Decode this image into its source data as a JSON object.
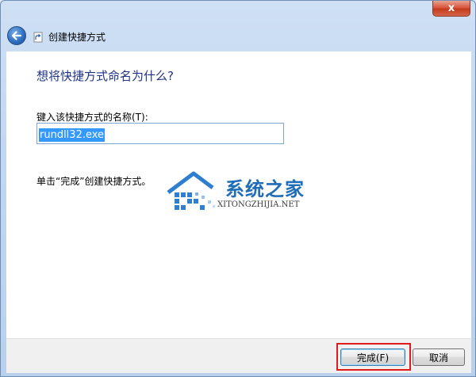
{
  "window": {
    "close_label": "x",
    "title": "创建快捷方式"
  },
  "page": {
    "heading": "想将快捷方式命名为什么?",
    "field_label": "键入该快捷方式的名称(T):",
    "name_value": "rundll32.exe",
    "hint": "单击“完成”创建快捷方式。"
  },
  "watermark": {
    "brand": "系统之家",
    "site": "XITONGZHIJIA.NET"
  },
  "footer": {
    "finish_label": "完成(F)",
    "cancel_label": "取消"
  }
}
